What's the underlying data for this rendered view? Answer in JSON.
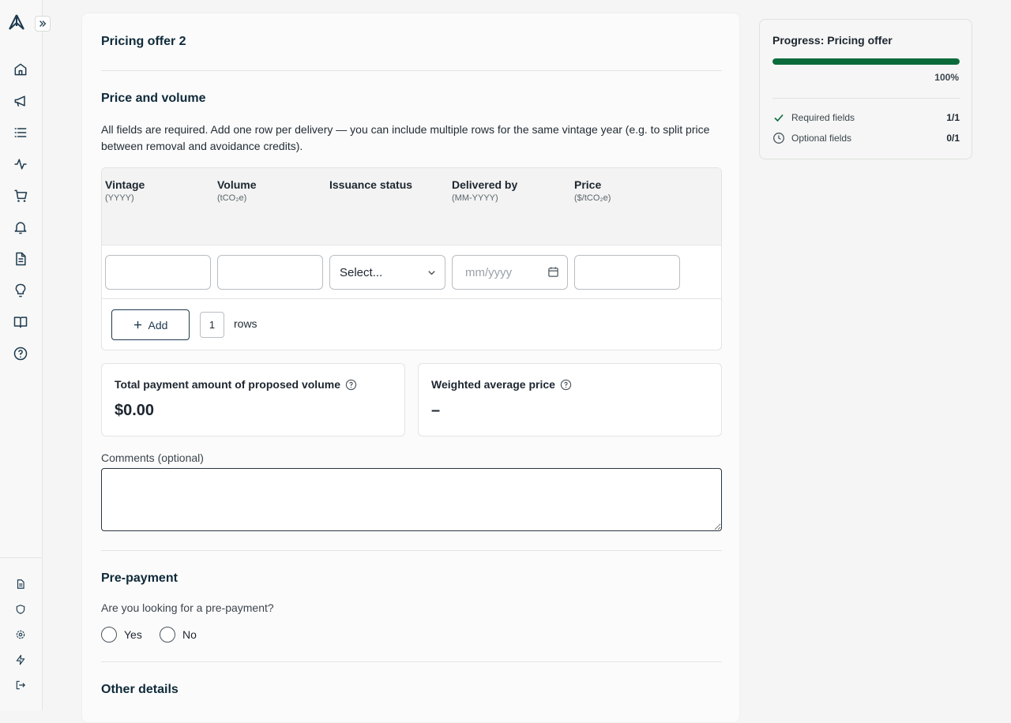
{
  "app": {
    "accent": "#0b6b3a",
    "brand": "#0f2a3a"
  },
  "sidebar": {
    "nav_icons": [
      "home-icon",
      "megaphone-icon",
      "list-icon",
      "activity-icon",
      "cart-icon",
      "bell-icon",
      "document-icon",
      "lightbulb-icon",
      "book-icon",
      "help-icon"
    ],
    "bottom_icons": [
      "document-icon",
      "shield-icon",
      "gear-icon",
      "bolt-icon",
      "logout-icon"
    ]
  },
  "form": {
    "title": "Pricing offer 2",
    "price_volume": {
      "title": "Price and volume",
      "description": "All fields are required. Add one row per delivery — you can include multiple rows for the same vintage year (e.g. to split price between removal and avoidance credits).",
      "columns": [
        {
          "label": "Vintage",
          "sub": "(YYYY)"
        },
        {
          "label": "Volume",
          "sub": "(tCO₂e)"
        },
        {
          "label": "Issuance status",
          "sub": ""
        },
        {
          "label": "Delivered by",
          "sub": "(MM-YYYY)"
        },
        {
          "label": "Price",
          "sub": "($/tCO₂e)"
        }
      ],
      "row": {
        "vintage": "",
        "volume": "",
        "issuance_status": "Select...",
        "delivered_by_placeholder": "mm/yyyy",
        "price": ""
      },
      "add_label": "Add",
      "rows_count": "1",
      "rows_label": "rows"
    },
    "totals": {
      "total_label": "Total payment amount of proposed volume",
      "total_value": "$0.00",
      "avg_label": "Weighted average price",
      "avg_value": "–"
    },
    "comments_label": "Comments (optional)",
    "prepayment": {
      "title": "Pre-payment",
      "question": "Are you looking for a pre-payment?",
      "options": [
        "Yes",
        "No"
      ]
    },
    "other_title": "Other details"
  },
  "progress": {
    "title": "Progress: Pricing offer",
    "percent": 100,
    "percent_label": "100%",
    "required_label": "Required fields",
    "required_count": "1/1",
    "optional_label": "Optional fields",
    "optional_count": "0/1"
  }
}
